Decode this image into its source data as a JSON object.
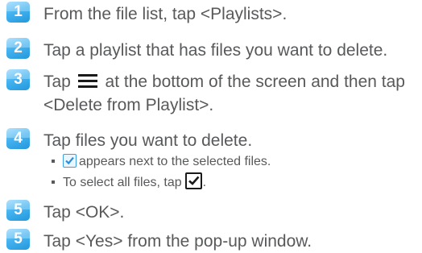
{
  "steps": [
    {
      "num": "1",
      "text": "From the file list, tap <Playlists>."
    },
    {
      "num": "2",
      "text": "Tap a playlist that has files you want to delete."
    },
    {
      "num": "3",
      "text_before": "Tap",
      "text_after": "at the bottom of the screen and then tap",
      "text_line2": "<Delete from Playlist>."
    },
    {
      "num": "4",
      "text": "Tap files you want to delete."
    },
    {
      "num": "5",
      "text": "Tap <OK>."
    },
    {
      "num": "5",
      "text": "Tap <Yes> from the pop-up window."
    }
  ],
  "sub_items": [
    {
      "icon": "checkbox-checked-icon",
      "text": "appears next to the selected files."
    },
    {
      "text_before": "To select all files, tap",
      "icon": "select-all-checkbox-icon",
      "text_after": "."
    }
  ],
  "icons": {
    "menu": "menu-icon"
  },
  "colors": {
    "badge": "#45b3f0",
    "text": "#58595b",
    "check": "#3a9ee0"
  }
}
